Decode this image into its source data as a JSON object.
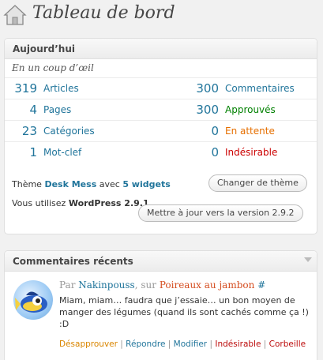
{
  "header": {
    "title": "Tableau de bord",
    "icon": "home-icon"
  },
  "today": {
    "title": "Aujourd’hui",
    "subtitle": "En un coup d’œil",
    "stats_left": [
      {
        "value": "319",
        "label": "Articles"
      },
      {
        "value": "4",
        "label": "Pages"
      },
      {
        "value": "23",
        "label": "Catégories"
      },
      {
        "value": "1",
        "label": "Mot-clef"
      }
    ],
    "stats_right": [
      {
        "value": "300",
        "label": "Commentaires"
      },
      {
        "value": "300",
        "label": "Approuvés"
      },
      {
        "value": "0",
        "label": "En attente"
      },
      {
        "value": "0",
        "label": "Indésirable"
      }
    ],
    "theme_prefix": "Thème",
    "theme_name": "Desk Mess",
    "theme_middle": "avec",
    "widgets": "5 widgets",
    "change_theme_button": "Changer de thème",
    "wp_prefix": "Vous utilisez",
    "wp_version": "WordPress 2.9.1",
    "update_button": "Mettre à jour vers la version 2.9.2"
  },
  "comments": {
    "title": "Commentaires récents",
    "items": [
      {
        "by": "Par",
        "author": "Nakinpouss",
        "on": ", sur",
        "post": "Poireaux au jambon",
        "hash": "#",
        "text": "Miam, miam… faudra que j’essaie… un bon moyen de manger des légumes (quand ils sont cachés comme ça !) :D",
        "actions": {
          "unapprove": "Désapprouver",
          "reply": "Répondre",
          "edit": "Modifier",
          "spam": "Indésirable",
          "trash": "Corbeille",
          "sep": "|"
        }
      }
    ]
  },
  "colors": {
    "link": "#21759b",
    "approved": "#008000",
    "pending": "#e66f00",
    "spam": "#cc0000"
  }
}
